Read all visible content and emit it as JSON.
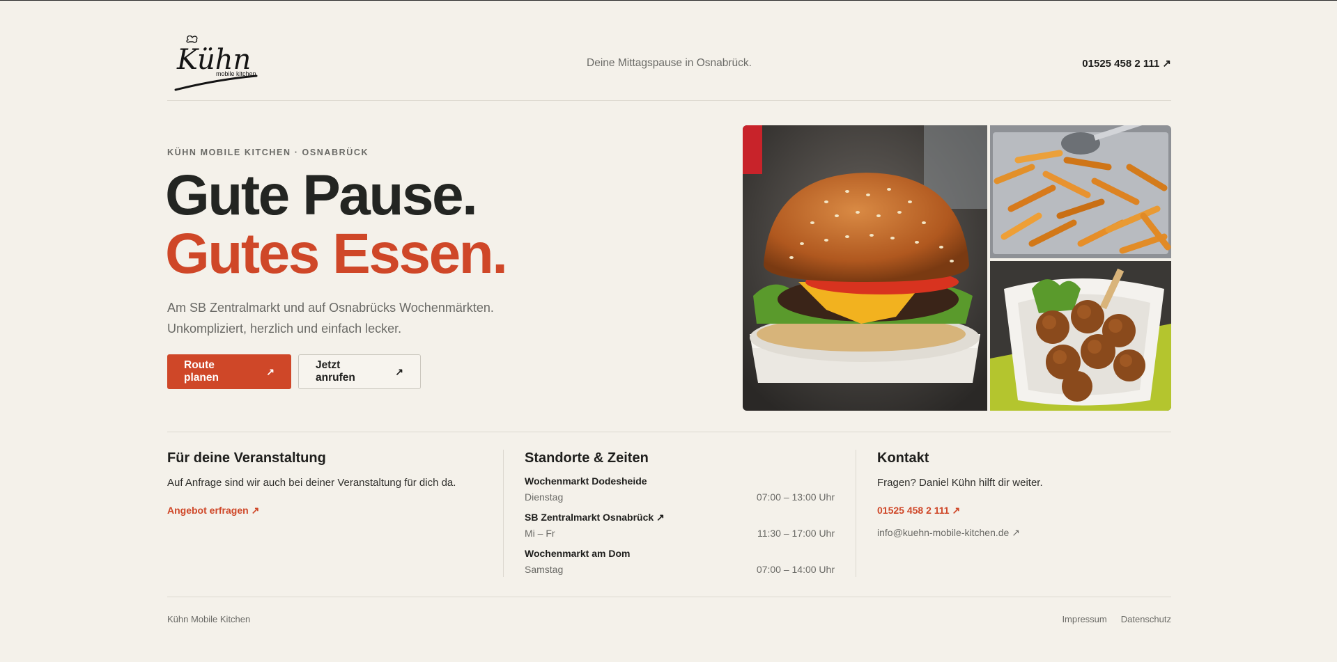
{
  "header": {
    "logo_text": "Kühn",
    "logo_subtext": "mobile kitchen",
    "tagline": "Deine Mittagspause in Osnabrück.",
    "phone": "01525 458 2 111 ↗"
  },
  "hero": {
    "eyebrow": "KÜHN MOBILE KITCHEN · OSNABRÜCK",
    "title_line1": "Gute Pause.",
    "title_line2": "Gutes Essen.",
    "lead_line1": "Am SB Zentralmarkt und auf Osnabrücks Wochenmärkten.",
    "lead_line2": "Unkompliziert, herzlich und einfach lecker.",
    "primary_button": "Route planen",
    "primary_button_icon": "↗",
    "secondary_button": "Jetzt anrufen",
    "secondary_button_icon": "↗"
  },
  "event": {
    "title": "Für deine Veranstaltung",
    "text": "Auf Anfrage sind wir auch bei deiner Veranstaltung für dich da.",
    "link": "Angebot erfragen ↗"
  },
  "locations": {
    "title": "Standorte & Zeiten",
    "items": [
      {
        "name": "Wochenmarkt Dodesheide",
        "day": "Dienstag",
        "time": "07:00 – 13:00 Uhr"
      },
      {
        "name": "SB Zentralmarkt Osnabrück ↗",
        "day": "Mi – Fr",
        "time": "11:30 – 17:00 Uhr"
      },
      {
        "name": "Wochenmarkt am Dom",
        "day": "Samstag",
        "time": "07:00 – 14:00 Uhr"
      }
    ]
  },
  "contact": {
    "title": "Kontakt",
    "text": "Fragen? Daniel Kühn hilft dir weiter.",
    "phone": "01525 458 2 111 ↗",
    "email": "info@kuehn-mobile-kitchen.de ↗"
  },
  "footer": {
    "brand": "Kühn Mobile Kitchen",
    "links": [
      "Impressum",
      "Datenschutz"
    ]
  },
  "colors": {
    "background": "#f4f1ea",
    "accent": "#cf4728",
    "text": "#1e1e1c",
    "muted": "#6a6a66"
  }
}
